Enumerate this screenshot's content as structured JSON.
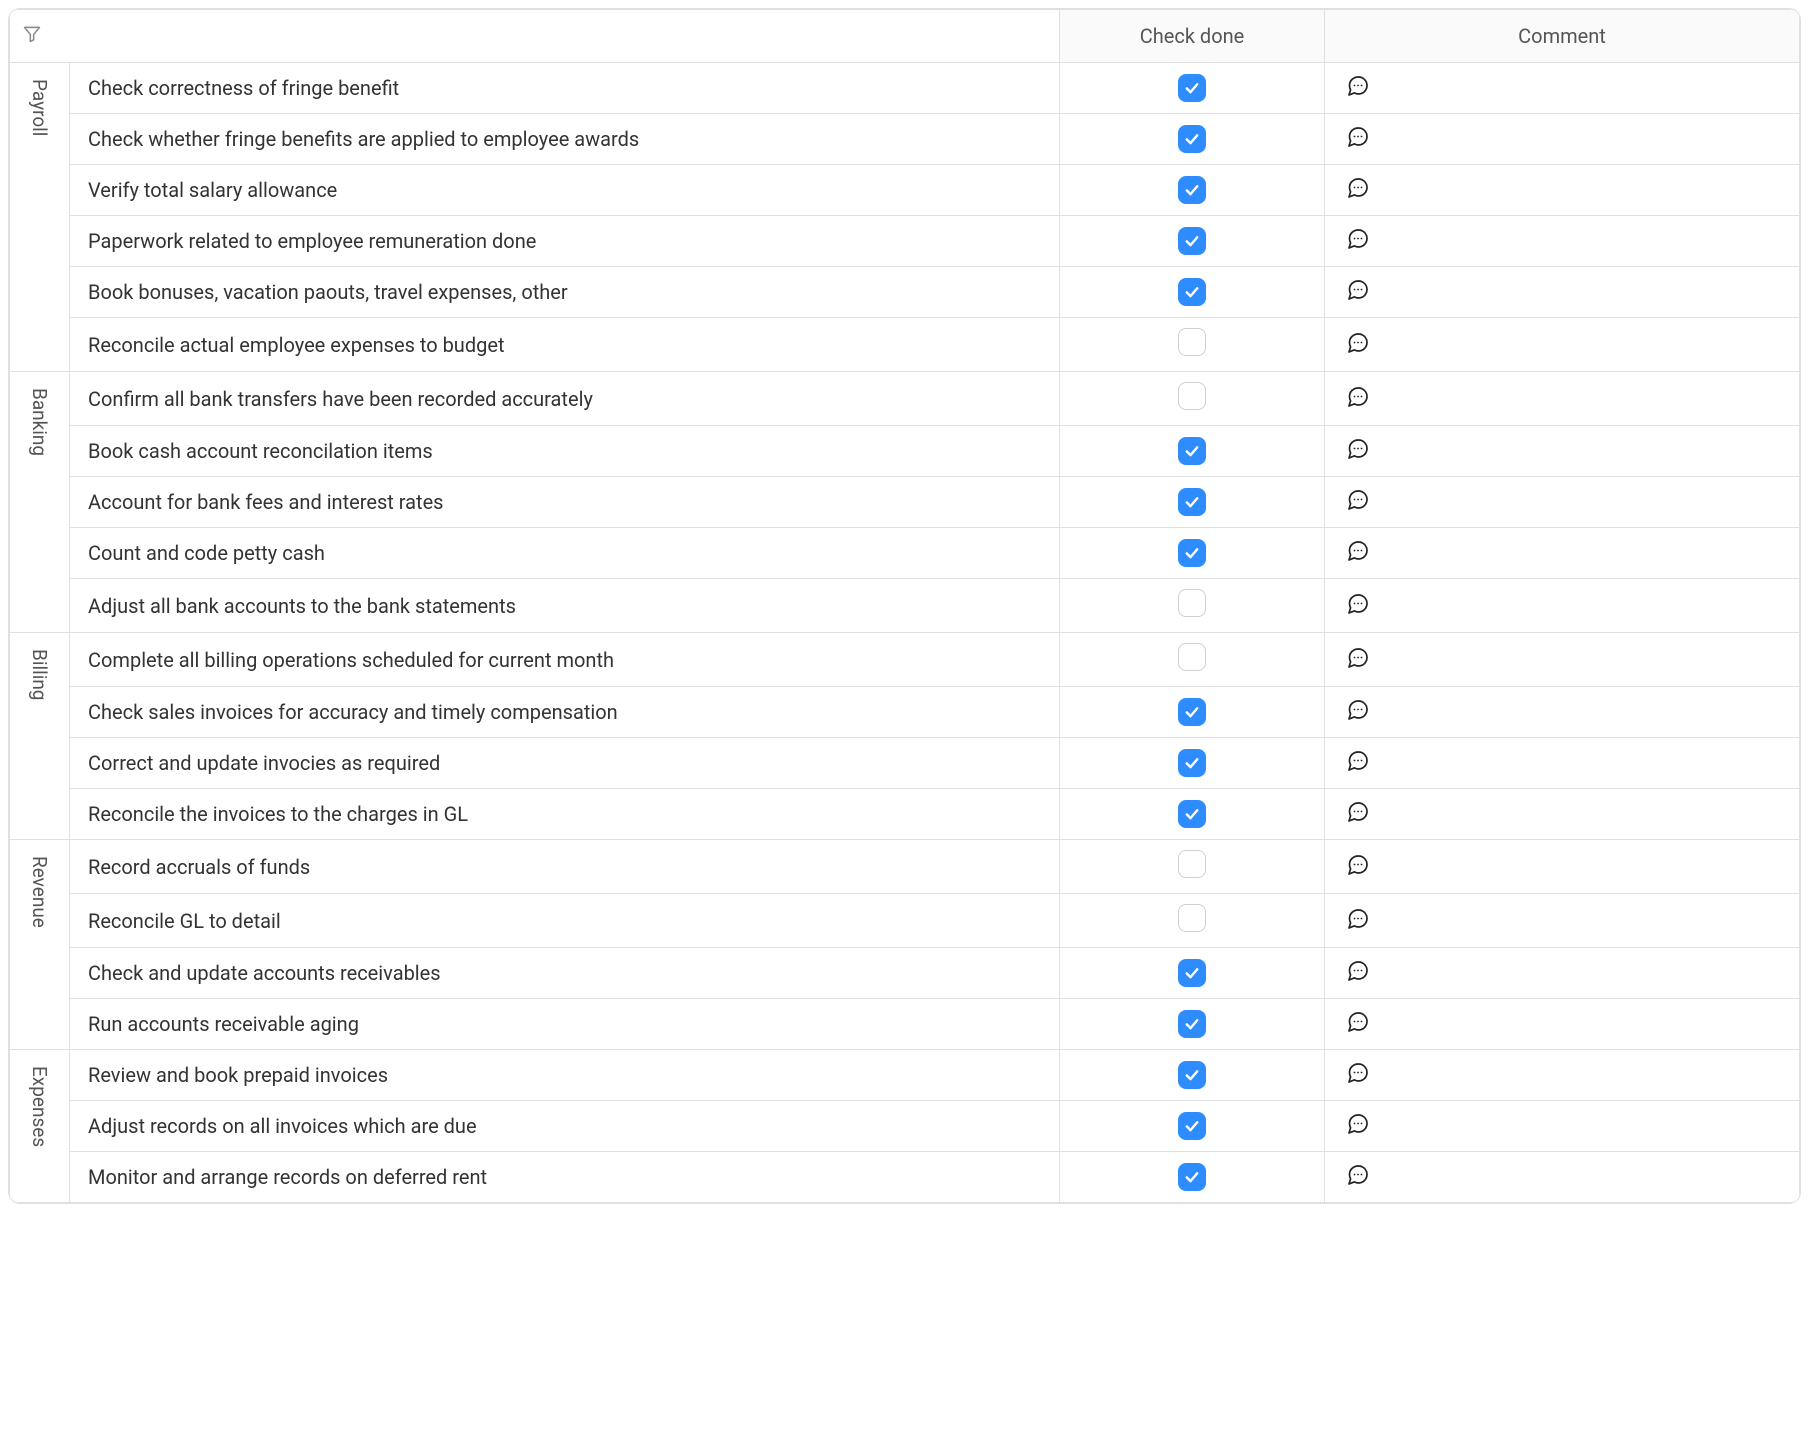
{
  "headers": {
    "check_done": "Check done",
    "comment": "Comment"
  },
  "groups": [
    {
      "name": "Payroll",
      "tasks": [
        {
          "label": "Check correctness of fringe benefit",
          "checked": true
        },
        {
          "label": "Check whether fringe benefits are applied to employee awards",
          "checked": true
        },
        {
          "label": "Verify total salary allowance",
          "checked": true
        },
        {
          "label": "Paperwork related to employee remuneration done",
          "checked": true
        },
        {
          "label": "Book bonuses, vacation paouts, travel expenses, other",
          "checked": true
        },
        {
          "label": "Reconcile actual employee expenses to budget",
          "checked": false
        }
      ]
    },
    {
      "name": "Banking",
      "tasks": [
        {
          "label": "Confirm all bank transfers have been recorded accurately",
          "checked": false
        },
        {
          "label": "Book cash account reconcilation items",
          "checked": true
        },
        {
          "label": "Account for bank fees and interest rates",
          "checked": true
        },
        {
          "label": "Count and code petty cash",
          "checked": true
        },
        {
          "label": "Adjust all bank accounts to the bank statements",
          "checked": false
        }
      ]
    },
    {
      "name": "Billing",
      "tasks": [
        {
          "label": "Complete all billing operations scheduled for current month",
          "checked": false
        },
        {
          "label": "Check sales invoices for accuracy and timely compensation",
          "checked": true
        },
        {
          "label": "Correct and update invocies as required",
          "checked": true
        },
        {
          "label": "Reconcile the invoices to the charges in GL",
          "checked": true
        }
      ]
    },
    {
      "name": "Revenue",
      "tasks": [
        {
          "label": "Record accruals of funds",
          "checked": false
        },
        {
          "label": "Reconcile GL to detail",
          "checked": false
        },
        {
          "label": "Check and update accounts receivables",
          "checked": true
        },
        {
          "label": "Run accounts receivable aging",
          "checked": true
        }
      ]
    },
    {
      "name": "Expenses",
      "tasks": [
        {
          "label": "Review and book prepaid invoices",
          "checked": true
        },
        {
          "label": "Adjust records on all invoices which are due",
          "checked": true
        },
        {
          "label": "Monitor and arrange records on deferred rent",
          "checked": true
        }
      ]
    }
  ]
}
